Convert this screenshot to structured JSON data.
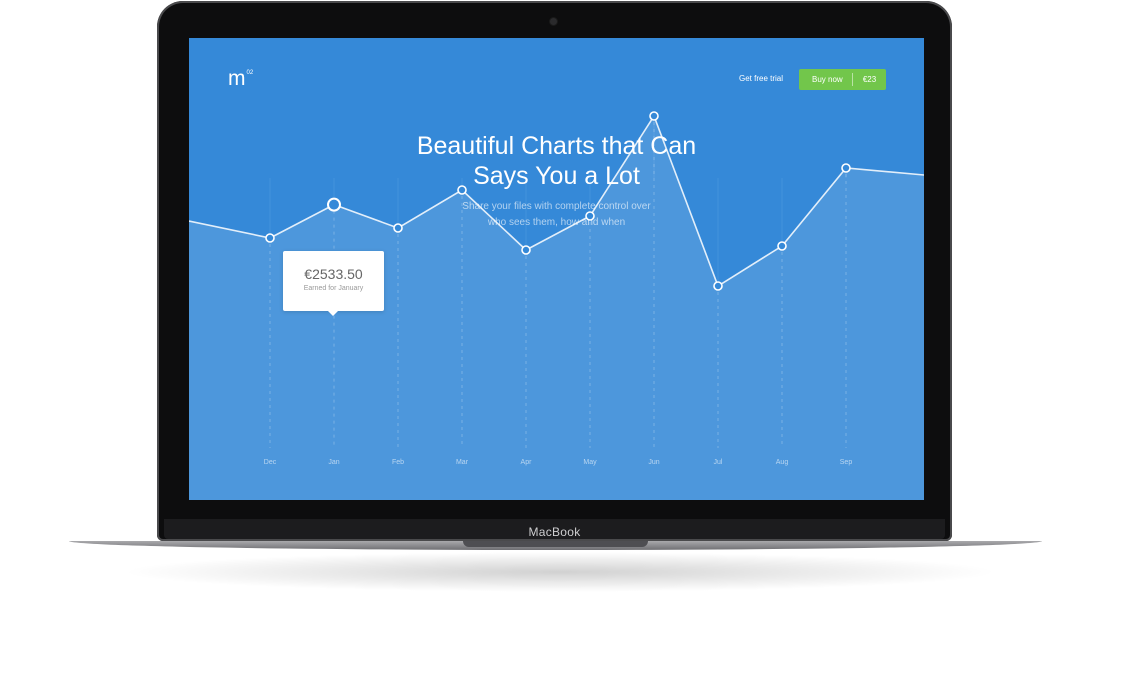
{
  "device": {
    "brand": "MacBook"
  },
  "header": {
    "logo_text": "m",
    "logo_sup": "02",
    "free_trial": "Get free trial",
    "buy_label": "Buy now",
    "buy_price": "€23"
  },
  "hero": {
    "title_line1": "Beautiful Charts that Can",
    "title_line2": "Says You a Lot",
    "subtitle_line1": "Share your files with complete control over",
    "subtitle_line2": "who sees them, how and when"
  },
  "tooltip": {
    "value": "€2533.50",
    "label": "Earned for January"
  },
  "colors": {
    "background": "#3589d8",
    "button": "#72c64b",
    "line": "#ffffff"
  },
  "chart_data": {
    "type": "area",
    "categories": [
      "Dec",
      "Jan",
      "Feb",
      "Mar",
      "Apr",
      "May",
      "Jun",
      "Jul",
      "Aug",
      "Sep"
    ],
    "values": [
      2200,
      2533.5,
      2300,
      2680,
      2080,
      2420,
      3420,
      1720,
      2120,
      2900
    ],
    "highlighted": "Jan",
    "ylim": [
      0,
      4200
    ],
    "grid": false
  }
}
